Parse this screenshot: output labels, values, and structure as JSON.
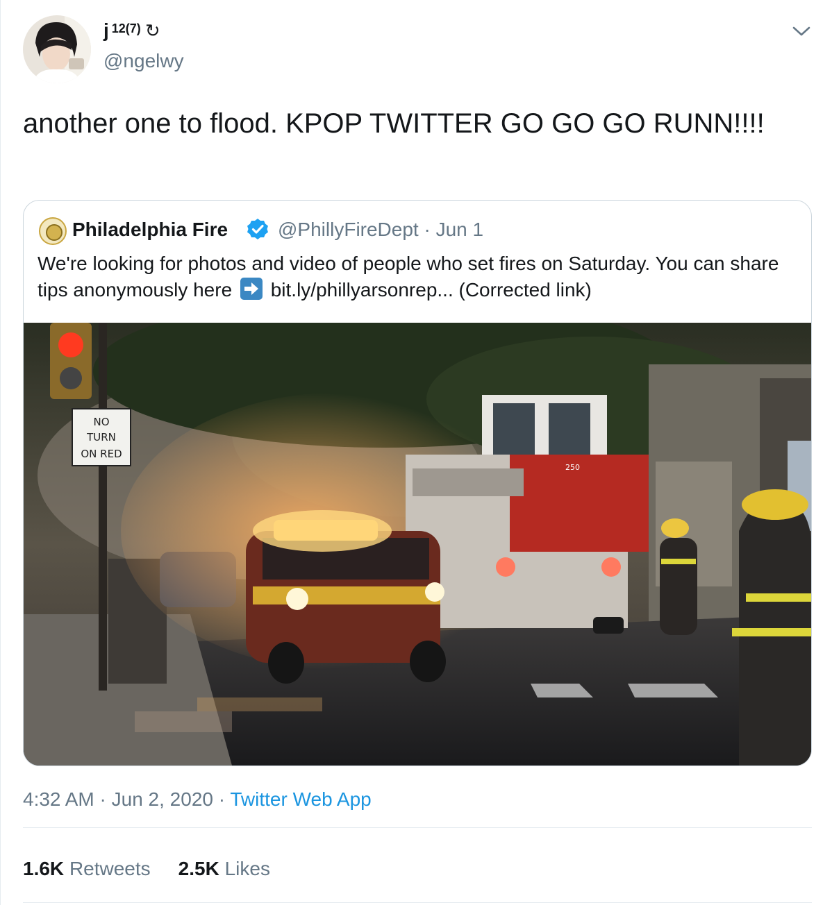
{
  "author": {
    "name": "j",
    "superscript": "12(7)",
    "symbol": "↻",
    "handle": "@ngelwy"
  },
  "tweet_text": "another one to flood. KPOP TWITTER GO GO GO RUNN!!!!",
  "quoted": {
    "name": "Philadelphia Fire",
    "handle": "@PhillyFireDept",
    "separator": "·",
    "date": "Jun 1",
    "text_before": "We're looking for photos and video of people who set fires on Saturday. You can share tips anonymously here",
    "text_after": "bit.ly/phillyarsonrep... (Corrected link)",
    "photo_signs": {
      "line1": "NO",
      "line2": "TURN",
      "line3": "ON RED",
      "truck_number": "250"
    }
  },
  "meta": {
    "time": "4:32 AM",
    "sep1": "·",
    "date": "Jun 2, 2020",
    "sep2": "·",
    "app": "Twitter Web App"
  },
  "stats": {
    "retweets_count": "1.6K",
    "retweets_label": "Retweets",
    "likes_count": "2.5K",
    "likes_label": "Likes"
  },
  "colors": {
    "link": "#1b95e0",
    "secondary": "#657786",
    "verified": "#1da1f2"
  }
}
